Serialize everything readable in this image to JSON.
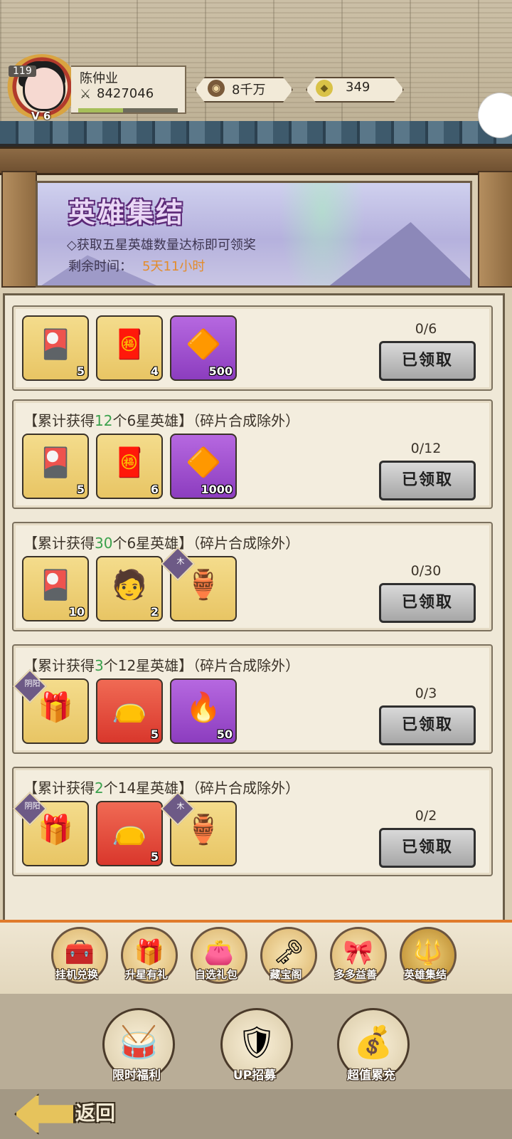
{
  "player": {
    "level": "119",
    "vip": "V 6",
    "name": "陈仲业",
    "power": "8427046",
    "exp_fraction": 0.45
  },
  "resources": [
    {
      "icon": "coin-icon",
      "value": "8千万"
    },
    {
      "icon": "ingot-icon",
      "value": "349"
    }
  ],
  "banner": {
    "title": "英雄集结",
    "description": "◇获取五星英雄数量达标即可领奖",
    "time_label": "剩余时间：",
    "time_value": "5天11小时"
  },
  "rows": [
    {
      "title_prefix": "",
      "highlight": "",
      "title_suffix": "",
      "note": "",
      "progress": "0/6",
      "button": "已领取",
      "items": [
        {
          "icon": "summon-order-icon",
          "count": "5",
          "bg": "gold"
        },
        {
          "icon": "lottery-ticket-icon",
          "count": "4",
          "bg": "gold"
        },
        {
          "icon": "jade-crystal-icon",
          "count": "500",
          "bg": "purple"
        }
      ]
    },
    {
      "title_prefix": "【累计获得",
      "highlight": "12",
      "title_suffix": "个6星英雄】",
      "note": "（碎片合成除外）",
      "progress": "0/12",
      "button": "已领取",
      "items": [
        {
          "icon": "summon-order-icon",
          "count": "5",
          "bg": "gold"
        },
        {
          "icon": "lottery-ticket-icon",
          "count": "6",
          "bg": "gold"
        },
        {
          "icon": "jade-crystal-icon",
          "count": "1000",
          "bg": "purple"
        }
      ]
    },
    {
      "title_prefix": "【累计获得",
      "highlight": "30",
      "title_suffix": "个6星英雄】",
      "note": "（碎片合成除外）",
      "progress": "0/30",
      "button": "已领取",
      "items": [
        {
          "icon": "summon-order-icon",
          "count": "10",
          "bg": "gold"
        },
        {
          "icon": "hero-portrait-icon",
          "count": "2",
          "bg": "gold"
        },
        {
          "icon": "golden-seal-icon",
          "count": "",
          "bg": "gold",
          "tag": "木"
        }
      ]
    },
    {
      "title_prefix": "【累计获得",
      "highlight": "3",
      "title_suffix": "个12星英雄】",
      "note": "（碎片合成除外）",
      "progress": "0/3",
      "button": "已领取",
      "items": [
        {
          "icon": "yinyang-box-icon",
          "count": "",
          "bg": "gold",
          "tag": "阴阳"
        },
        {
          "icon": "red-pouch-icon",
          "count": "5",
          "bg": "red"
        },
        {
          "icon": "fire-gem-icon",
          "count": "50",
          "bg": "purple"
        }
      ]
    },
    {
      "title_prefix": "【累计获得",
      "highlight": "2",
      "title_suffix": "个14星英雄】",
      "note": "（碎片合成除外）",
      "progress": "0/2",
      "button": "已领取",
      "items": [
        {
          "icon": "yinyang-box-icon",
          "count": "",
          "bg": "gold",
          "tag": "阴阳"
        },
        {
          "icon": "red-pouch-icon",
          "count": "5",
          "bg": "red"
        },
        {
          "icon": "golden-seal-icon",
          "count": "",
          "bg": "gold",
          "tag": "木"
        }
      ]
    }
  ],
  "tabs": [
    {
      "label": "挂机兑换",
      "icon": "treasure-chest-icon"
    },
    {
      "label": "升星有礼",
      "icon": "gift-box-icon"
    },
    {
      "label": "自选礼包",
      "icon": "gift-bag-icon"
    },
    {
      "label": "藏宝阁",
      "icon": "key-icon"
    },
    {
      "label": "多多益善",
      "icon": "red-gift-icon"
    },
    {
      "label": "英雄集结",
      "icon": "gold-emblem-icon"
    }
  ],
  "bottom_nav": [
    {
      "label": "限时福利",
      "icon": "drum-icon"
    },
    {
      "label": "UP招募",
      "icon": "banner-scroll-icon"
    },
    {
      "label": "超值累充",
      "icon": "money-pouch-icon"
    }
  ],
  "back_label": "返回",
  "colors": {
    "highlight_green": "#3aa14c",
    "time_orange": "#e38c2a",
    "button_gray": "#b9b9b9",
    "tab_border_orange": "#e07a2c"
  }
}
